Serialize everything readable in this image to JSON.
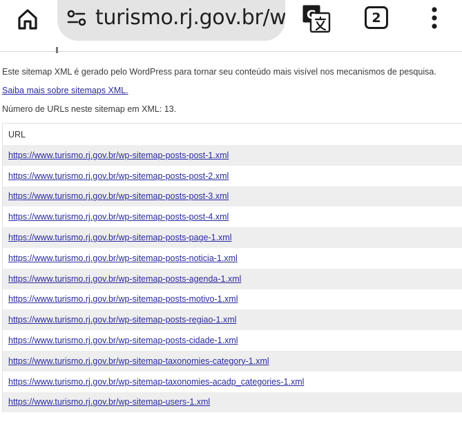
{
  "browser": {
    "url_text": "turismo.rj.gov.br/wp-",
    "tab_count": "2",
    "icons": {
      "home": "home-icon",
      "site_settings": "tune-icon",
      "translate": "translate-icon",
      "menu": "more-vert-icon"
    }
  },
  "page": {
    "intro": "Este sitemap XML é gerado pelo WordPress para tornar seu conteúdo mais visível nos mecanismos de pesquisa.",
    "learn_more": "Saiba mais sobre sitemaps XML.",
    "url_count_text": "Número de URLs neste sitemap em XML: 13.",
    "table_header": "URL",
    "urls": [
      "https://www.turismo.rj.gov.br/wp-sitemap-posts-post-1.xml",
      "https://www.turismo.rj.gov.br/wp-sitemap-posts-post-2.xml",
      "https://www.turismo.rj.gov.br/wp-sitemap-posts-post-3.xml",
      "https://www.turismo.rj.gov.br/wp-sitemap-posts-post-4.xml",
      "https://www.turismo.rj.gov.br/wp-sitemap-posts-page-1.xml",
      "https://www.turismo.rj.gov.br/wp-sitemap-posts-noticia-1.xml",
      "https://www.turismo.rj.gov.br/wp-sitemap-posts-agenda-1.xml",
      "https://www.turismo.rj.gov.br/wp-sitemap-posts-motivo-1.xml",
      "https://www.turismo.rj.gov.br/wp-sitemap-posts-regiao-1.xml",
      "https://www.turismo.rj.gov.br/wp-sitemap-posts-cidade-1.xml",
      "https://www.turismo.rj.gov.br/wp-sitemap-taxonomies-category-1.xml",
      "https://www.turismo.rj.gov.br/wp-sitemap-taxonomies-acadp_categories-1.xml",
      "https://www.turismo.rj.gov.br/wp-sitemap-users-1.xml"
    ]
  },
  "colors": {
    "link": "#2a2a9e",
    "urlbar_bg": "#e4e4e4",
    "row_stripe": "#eeeeee"
  }
}
